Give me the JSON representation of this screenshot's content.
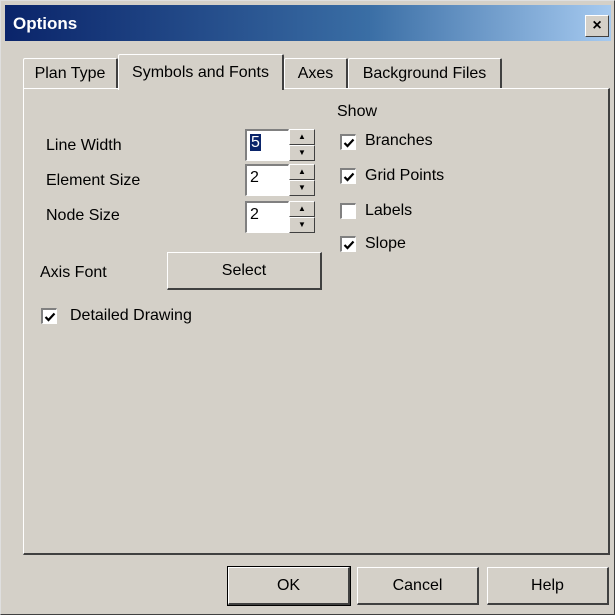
{
  "window": {
    "title": "Options",
    "close_label": "×"
  },
  "tabs": [
    {
      "label": "Plan Type",
      "active": false
    },
    {
      "label": "Symbols and Fonts",
      "active": true
    },
    {
      "label": "Axes",
      "active": false
    },
    {
      "label": "Background Files",
      "active": false
    }
  ],
  "symbols": {
    "line_width": {
      "label": "Line Width",
      "value": "5"
    },
    "element_size": {
      "label": "Element Size",
      "value": "2"
    },
    "node_size": {
      "label": "Node Size",
      "value": "2"
    },
    "axis_font": {
      "label": "Axis Font",
      "button": "Select"
    },
    "detailed_drawing": {
      "label": "Detailed Drawing",
      "checked": true
    }
  },
  "show": {
    "heading": "Show",
    "items": [
      {
        "label": "Branches",
        "checked": true
      },
      {
        "label": "Grid Points",
        "checked": true
      },
      {
        "label": "Labels",
        "checked": false
      },
      {
        "label": "Slope",
        "checked": true
      }
    ]
  },
  "buttons": {
    "ok": "OK",
    "cancel": "Cancel",
    "help": "Help"
  },
  "icons": {
    "spin_up": "up-arrow-icon",
    "spin_down": "down-arrow-icon",
    "check": "checkmark-icon"
  }
}
